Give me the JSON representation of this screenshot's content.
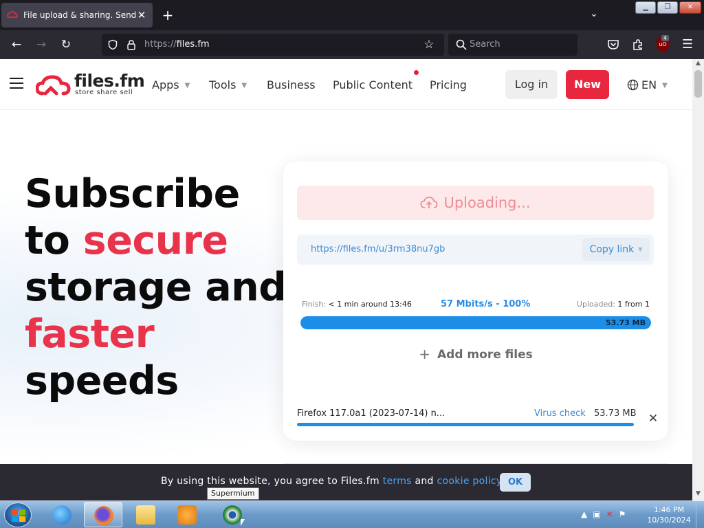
{
  "browser": {
    "tab_title": "File upload & sharing. Send large files",
    "url_protocol": "https://",
    "url_host": "files.fm",
    "search_placeholder": "Search",
    "ublock_count": "4"
  },
  "site": {
    "logo_name": "files.fm",
    "logo_tagline": "store  share  sell",
    "menu": {
      "apps": "Apps",
      "tools": "Tools",
      "business": "Business",
      "public_content": "Public Content",
      "pricing": "Pricing"
    },
    "login": "Log in",
    "new": "New",
    "lang": "EN"
  },
  "hero": {
    "line1": "Subscribe",
    "line2a": "to ",
    "line2b": "secure",
    "line3": "storage and",
    "line4": "faster",
    "line5": "speeds"
  },
  "upload": {
    "status": "Uploading...",
    "link": "https://files.fm/u/3rm38nu7gb",
    "copy_link": "Copy link",
    "finish_label": "Finish:",
    "finish_value": " < 1 min around 13:46",
    "speed": "57 Mbits/s - 100%",
    "uploaded_label": "Uploaded:",
    "uploaded_value": " 1 from 1",
    "progress_percent": 100,
    "total_size": "53.73 MB",
    "add_more": "Add more files",
    "file_name": "Firefox 117.0a1 (2023-07-14) n...",
    "virus_check": "Virus check",
    "file_size": "53.73 MB",
    "file_progress_percent": 100
  },
  "cookie": {
    "text1": "By using this website, you agree to Files.fm ",
    "terms": "terms",
    "text2": " and ",
    "policy": "cookie policy.",
    "ok": "OK"
  },
  "tooltip": "Supermium",
  "taskbar": {
    "time": "1:46 PM",
    "date": "10/30/2024"
  },
  "colors": {
    "brand_red": "#e8273f",
    "link_blue": "#3a8ad3",
    "progress_blue": "#1c8ee8"
  }
}
